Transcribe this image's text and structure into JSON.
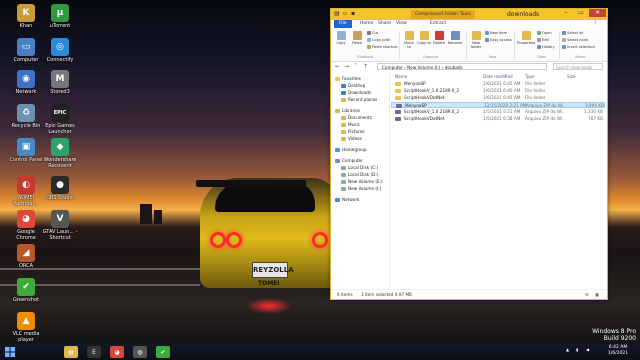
{
  "desktop": {
    "icons": [
      {
        "label": "Khan",
        "color": "#c99b3a",
        "glyph": "K"
      },
      {
        "label": "uTorrent",
        "color": "#2f9a3e",
        "glyph": "µ"
      },
      {
        "label": "Computer",
        "color": "#4a7fc1",
        "glyph": "▭"
      },
      {
        "label": "Connectify",
        "color": "#2a8bd8",
        "glyph": "◎"
      },
      {
        "label": "Network",
        "color": "#3b74c4",
        "glyph": "◉"
      },
      {
        "label": "Stored3",
        "color": "#777",
        "glyph": "M"
      },
      {
        "label": "Recycle Bin",
        "color": "#6d8fb0",
        "glyph": "♻"
      },
      {
        "label": "Epic Games Launcher",
        "color": "#222",
        "glyph": "EPIC"
      },
      {
        "label": "Control Panel",
        "color": "#4788c7",
        "glyph": "▣"
      },
      {
        "label": "Wondershare Recoverit",
        "color": "#2ca36a",
        "glyph": "◆"
      },
      {
        "label": "AOMEI Partition...",
        "color": "#c6382f",
        "glyph": "◐"
      },
      {
        "label": "OBS Studio",
        "color": "#2b2b2b",
        "glyph": "●"
      },
      {
        "label": "Google Chrome",
        "color": "#e0463a",
        "glyph": "◕"
      },
      {
        "label": "GTAV Laun... - Shortcut",
        "color": "#555",
        "glyph": "V"
      },
      {
        "label": "ORCA",
        "color": "#b45a2a",
        "glyph": "◢"
      },
      {
        "label": "Greenshot",
        "color": "#3cab3c",
        "glyph": "✔"
      },
      {
        "label": "VLC media player",
        "color": "#f08c00",
        "glyph": "▲"
      }
    ],
    "watermark": {
      "line1": "Windows 8 Pro",
      "line2": "Build 9200"
    },
    "plate": "REYZOLLA",
    "plate_brand": "TOMEI"
  },
  "explorer": {
    "context_tab": "Compressed Folder Tools",
    "title": "downloads",
    "tabs": [
      "File",
      "Home",
      "Share",
      "View",
      "Extract"
    ],
    "ribbon": {
      "clipboard": {
        "copy": "Copy",
        "paste": "Paste",
        "cut": "Cut",
        "copy_path": "Copy path",
        "paste_shortcut": "Paste shortcut",
        "group": "Clipboard"
      },
      "organize": {
        "move_to": "Move to",
        "copy_to": "Copy to",
        "delete": "Delete",
        "rename": "Rename",
        "group": "Organize"
      },
      "new": {
        "new_folder": "New folder",
        "new_item": "New item",
        "easy_access": "Easy access",
        "group": "New"
      },
      "open": {
        "properties": "Properties",
        "open": "Open",
        "edit": "Edit",
        "history": "History",
        "group": "Open"
      },
      "select": {
        "select_all": "Select all",
        "select_none": "Select none",
        "invert": "Invert selection",
        "group": "Select"
      }
    },
    "address": "Computer  ›  New Volume (I:)  ›  doubads",
    "search_placeholder": "Search downloads",
    "nav": [
      {
        "label": "Favorites",
        "color": "#f2c14e",
        "indent": 0
      },
      {
        "label": "Desktop",
        "color": "#3a7ad0",
        "indent": 1
      },
      {
        "label": "Downloads",
        "color": "#3a7ad0",
        "indent": 1
      },
      {
        "label": "Recent places",
        "color": "#e0b84a",
        "indent": 1
      },
      {
        "label": "Libraries",
        "color": "#e0b84a",
        "indent": 0
      },
      {
        "label": "Documents",
        "color": "#e0b84a",
        "indent": 1
      },
      {
        "label": "Music",
        "color": "#e0b84a",
        "indent": 1
      },
      {
        "label": "Pictures",
        "color": "#e0b84a",
        "indent": 1
      },
      {
        "label": "Videos",
        "color": "#e0b84a",
        "indent": 1
      },
      {
        "label": "Homegroup",
        "color": "#3aa0d8",
        "indent": 0
      },
      {
        "label": "Computer",
        "color": "#6a8fc4",
        "indent": 0
      },
      {
        "label": "Local Disk (C:)",
        "color": "#8aa",
        "indent": 1
      },
      {
        "label": "Local Disk (D:)",
        "color": "#8aa",
        "indent": 1
      },
      {
        "label": "New Volume (E:)",
        "color": "#8aa",
        "indent": 1
      },
      {
        "label": "New Volume (I:)",
        "color": "#8aa",
        "indent": 1
      },
      {
        "label": "Network",
        "color": "#4f8ad2",
        "indent": 0
      }
    ],
    "columns": {
      "name": "Name",
      "date": "Date modified",
      "type": "Type",
      "size": "Size"
    },
    "files": [
      {
        "name": "MenyooSP",
        "date": "1/6/2021 6:45 AM",
        "type": "File folder",
        "size": "",
        "icon_color": "#e8c15a",
        "selected": false
      },
      {
        "name": "ScriptHookV_1.0.2189.0_2",
        "date": "1/6/2021 6:40 AM",
        "type": "File folder",
        "size": "",
        "icon_color": "#e8c15a",
        "selected": false
      },
      {
        "name": "ScriptHookVDotNet",
        "date": "1/6/2021 6:45 AM",
        "type": "File folder",
        "size": "",
        "icon_color": "#e8c15a",
        "selected": false
      },
      {
        "name": "MenyooSP",
        "date": "12/15/2020 2:21 PM",
        "type": "Arquivo ZIP do Wi...",
        "size": "3,994 KB",
        "icon_color": "#6b6b9a",
        "selected": true
      },
      {
        "name": "ScriptHookV_1.0.2189.0_2",
        "date": "1/5/2021 5:21 AM",
        "type": "Arquivo ZIP do Wi...",
        "size": "1,330 KB",
        "icon_color": "#6b6b9a",
        "selected": false
      },
      {
        "name": "ScriptHookVDotNet",
        "date": "1/5/2021 6:38 AM",
        "type": "Arquivo ZIP do Wi...",
        "size": "767 KB",
        "icon_color": "#6b6b9a",
        "selected": false
      }
    ],
    "status": {
      "items": "6 items",
      "selected": "1 item selected  4.97 MB"
    }
  },
  "taskbar": {
    "apps": [
      {
        "name": "Windows Explorer",
        "glyph": "▤",
        "color": "#e0b84a"
      },
      {
        "name": "Epic Games",
        "glyph": "E",
        "color": "#333"
      },
      {
        "name": "Chrome",
        "glyph": "◕",
        "color": "#d9453a"
      },
      {
        "name": "Unknown app",
        "glyph": "◍",
        "color": "#555"
      },
      {
        "name": "Greenshot",
        "glyph": "✔",
        "color": "#3cab3c"
      }
    ],
    "clock": {
      "time": "6:42 AM",
      "date": "1/6/2021"
    }
  }
}
